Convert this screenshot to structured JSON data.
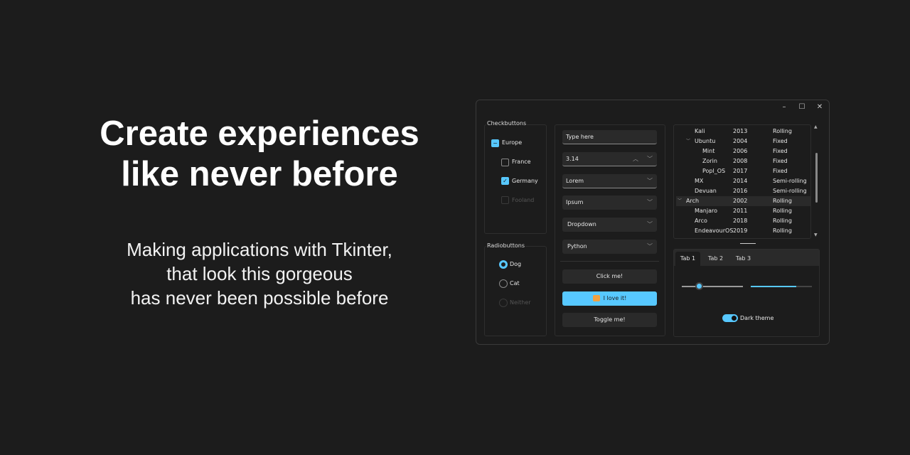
{
  "headline": [
    "Create experiences",
    "like never before"
  ],
  "subtitle": [
    "Making applications with Tkinter,",
    "that look this gorgeous",
    "has never been possible before"
  ],
  "window": {
    "controls": {
      "minimize": "–",
      "maximize": "☐",
      "close": "✕"
    }
  },
  "checkbuttons": {
    "title": "Checkbuttons",
    "items": [
      {
        "label": "Europe",
        "state": "indeterminate"
      },
      {
        "label": "France",
        "state": "unchecked"
      },
      {
        "label": "Germany",
        "state": "checked"
      },
      {
        "label": "Fooland",
        "state": "disabled"
      }
    ]
  },
  "radiobuttons": {
    "title": "Radiobuttons",
    "items": [
      {
        "label": "Dog",
        "state": "selected"
      },
      {
        "label": "Cat",
        "state": "unselected"
      },
      {
        "label": "Neither",
        "state": "disabled"
      }
    ]
  },
  "inputs": {
    "entry": "Type here",
    "spinbox": "3.14",
    "combo1": "Lorem",
    "combo2": "Ipsum",
    "menubutton": "Dropdown",
    "optionmenu": "Python"
  },
  "buttons": {
    "click": "Click me!",
    "accent": "I love it!",
    "toggle": "Toggle me!"
  },
  "tree": {
    "rows": [
      {
        "name": "Kali",
        "year": "2013",
        "type": "Rolling",
        "level": 1
      },
      {
        "name": "Ubuntu",
        "year": "2004",
        "type": "Fixed",
        "level": 1,
        "open": true
      },
      {
        "name": "Mint",
        "year": "2006",
        "type": "Fixed",
        "level": 2
      },
      {
        "name": "Zorin",
        "year": "2008",
        "type": "Fixed",
        "level": 2
      },
      {
        "name": "Popl_OS",
        "year": "2017",
        "type": "Fixed",
        "level": 2
      },
      {
        "name": "MX",
        "year": "2014",
        "type": "Semi-rolling",
        "level": 1
      },
      {
        "name": "Devuan",
        "year": "2016",
        "type": "Semi-rolling",
        "level": 1
      },
      {
        "name": "Arch",
        "year": "2002",
        "type": "Rolling",
        "level": 0,
        "open": true,
        "selected": true
      },
      {
        "name": "Manjaro",
        "year": "2011",
        "type": "Rolling",
        "level": 1
      },
      {
        "name": "Arco",
        "year": "2018",
        "type": "Rolling",
        "level": 1
      },
      {
        "name": "EndeavourOS",
        "year": "2019",
        "type": "Rolling",
        "level": 1
      }
    ]
  },
  "notebook": {
    "tabs": [
      "Tab 1",
      "Tab 2",
      "Tab 3"
    ],
    "active": 0,
    "scale_percent": 28,
    "progress_percent": 74,
    "switch_label": "Dark theme",
    "switch_on": true
  },
  "colors": {
    "accent": "#57c8ff",
    "background": "#1c1c1c"
  }
}
